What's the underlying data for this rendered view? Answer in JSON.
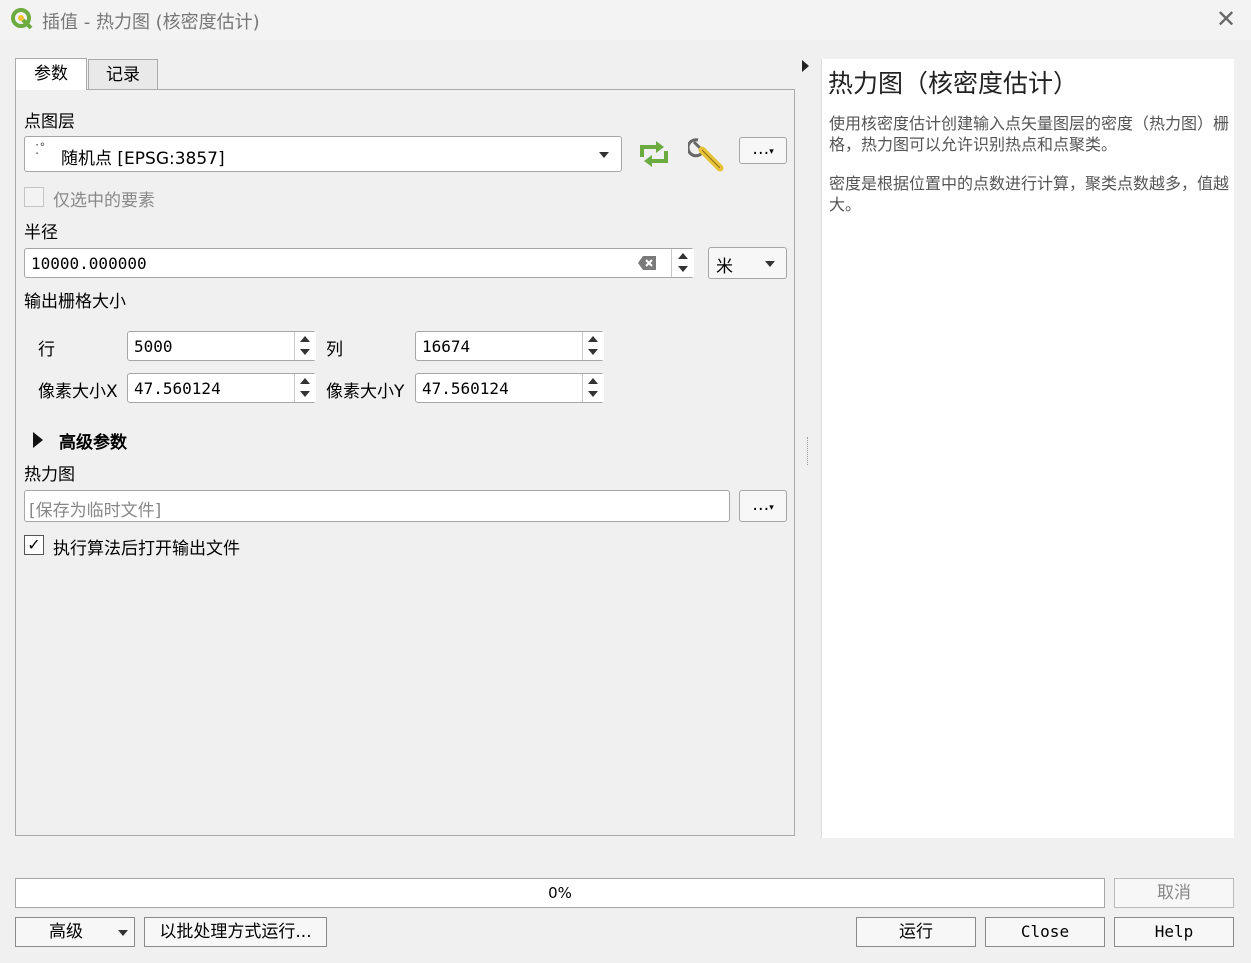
{
  "window": {
    "title": "插值 - 热力图 (核密度估计)",
    "close_icon": "close-icon",
    "app_icon": "qgis-logo-icon"
  },
  "tabs": [
    {
      "label": "参数",
      "active": true
    },
    {
      "label": "记录",
      "active": false
    }
  ],
  "params": {
    "point_layer_label": "点图层",
    "point_layer_value": "随机点 [EPSG:3857]",
    "more_button": "…",
    "selected_only_label": "仅选中的要素",
    "selected_only_checked": false,
    "radius_label": "半径",
    "radius_value": "10000.000000",
    "radius_unit": "米",
    "output_raster_label": "输出栅格大小",
    "rows_label": "行",
    "rows_value": "5000",
    "cols_label": "列",
    "cols_value": "16674",
    "pixel_x_label": "像素大小X",
    "pixel_x_value": "47.560124",
    "pixel_y_label": "像素大小Y",
    "pixel_y_value": "47.560124",
    "advanced_label": "高级参数",
    "heatmap_label": "热力图",
    "heatmap_placeholder": "[保存为临时文件]",
    "open_after_label": "执行算法后打开输出文件",
    "open_after_checked": true
  },
  "help": {
    "title": "热力图（核密度估计）",
    "p1": "使用核密度估计创建输入点矢量图层的密度（热力图）栅格，热力图可以允许识别热点和点聚类。",
    "p2": "密度是根据位置中的点数进行计算，聚类点数越多，值越大。"
  },
  "bottom": {
    "progress": "0%",
    "progress_fraction": 0,
    "cancel": "取消",
    "advanced": "高级",
    "batch": "以批处理方式运行...",
    "run": "运行",
    "close": "Close",
    "help": "Help"
  },
  "colors": {
    "accent_green": "#6bab3f",
    "wrench_yellow": "#e8c23a"
  }
}
